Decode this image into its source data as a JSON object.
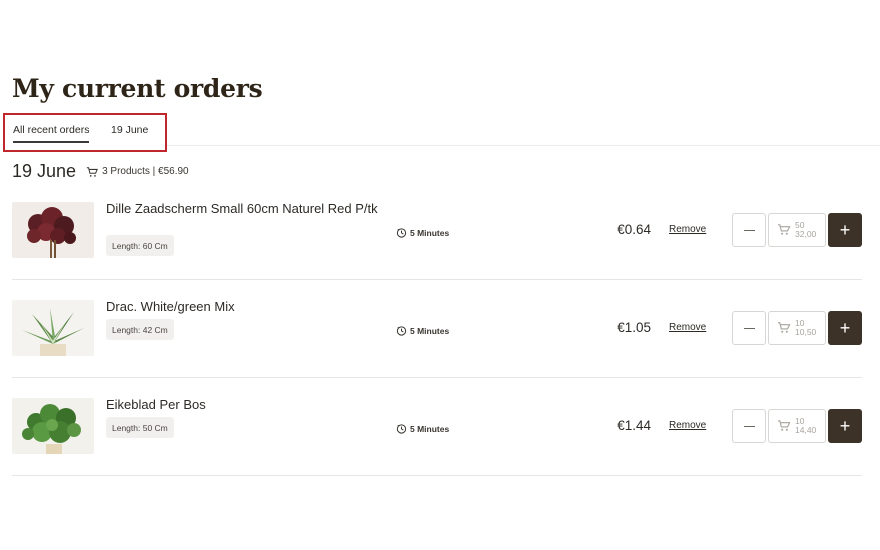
{
  "page_title": "My current orders",
  "tabs": [
    {
      "label": "All recent orders",
      "active": true
    },
    {
      "label": "19 June",
      "active": false
    }
  ],
  "order_group": {
    "date": "19 June",
    "summary": "3 Products | €56.90",
    "items": [
      {
        "name": "Dille Zaadscherm Small 60cm Naturel Red P/tk",
        "length": "Length: 60 Cm",
        "delivery": "5 Minutes",
        "price": "€0.64",
        "remove_label": "Remove",
        "quantity": "50",
        "quantity_total": "32,00",
        "thumb_icon": "red-dill-flower-image"
      },
      {
        "name": "Drac. White/green Mix",
        "length": "Length: 42 Cm",
        "delivery": "5 Minutes",
        "price": "€1.05",
        "remove_label": "Remove",
        "quantity": "10",
        "quantity_total": "10,50",
        "thumb_icon": "dracaena-plant-image"
      },
      {
        "name": "Eikeblad Per Bos",
        "length": "Length: 50 Cm",
        "delivery": "5 Minutes",
        "price": "€1.44",
        "remove_label": "Remove",
        "quantity": "10",
        "quantity_total": "14,40",
        "thumb_icon": "oak-leaf-bunch-image"
      }
    ]
  },
  "colors": {
    "title": "#2e2418",
    "highlight_border": "#c0272d",
    "add_button": "#3d3227"
  }
}
